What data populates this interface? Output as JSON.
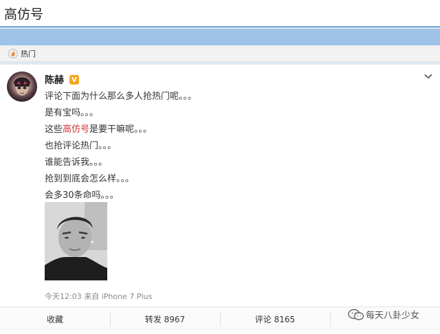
{
  "search": {
    "query": "高仿号"
  },
  "tab": {
    "label": "热门",
    "icon": "hot-flame-icon"
  },
  "post": {
    "author": "陈赫",
    "verified_badge": "V",
    "avatar_icon": "user-avatar",
    "lines": [
      "评论下面为什么那么多人抢热门呢。。。",
      "是有宝吗。。。",
      {
        "before": "这些",
        "highlight": "高仿号",
        "after": "是要干嘛呢。。。"
      },
      "也抢评论热门。。。",
      "谁能告诉我。。。",
      "抢到到底会怎么样。。。",
      "会多30条命吗。。。"
    ],
    "timestamp": "今天12:03 来自 iPhone 7 Plus",
    "actions": {
      "favorite": "收藏",
      "repost": "转发 8967",
      "comment": "评论 8165",
      "like": ""
    }
  },
  "watermark": {
    "text": "每天八卦少女",
    "icon": "wechat-icon"
  },
  "colors": {
    "highlight": "#d2302f",
    "top_band": "#9ec3e6",
    "badge": "#f5a623"
  }
}
